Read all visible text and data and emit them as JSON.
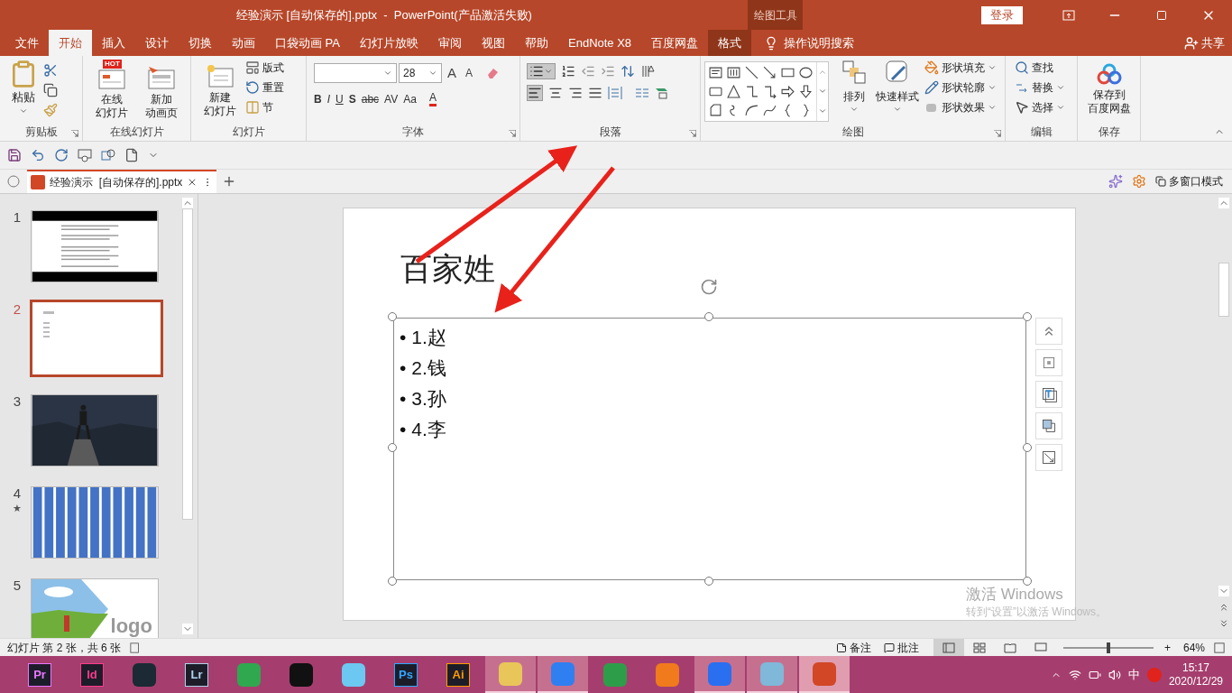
{
  "title_bar": {
    "title": "经验演示 [自动保存的].pptx  -  PowerPoint(产品激活失败)",
    "context_label": "绘图工具",
    "login_button": "登录"
  },
  "menu_tabs": [
    {
      "label": "文件",
      "selected": false,
      "kind": "normal"
    },
    {
      "label": "开始",
      "selected": true,
      "kind": "normal"
    },
    {
      "label": "插入",
      "selected": false,
      "kind": "normal"
    },
    {
      "label": "设计",
      "selected": false,
      "kind": "normal"
    },
    {
      "label": "切换",
      "selected": false,
      "kind": "normal"
    },
    {
      "label": "动画",
      "selected": false,
      "kind": "normal"
    },
    {
      "label": "口袋动画 PA",
      "selected": false,
      "kind": "normal"
    },
    {
      "label": "幻灯片放映",
      "selected": false,
      "kind": "normal"
    },
    {
      "label": "审阅",
      "selected": false,
      "kind": "normal"
    },
    {
      "label": "视图",
      "selected": false,
      "kind": "normal"
    },
    {
      "label": "帮助",
      "selected": false,
      "kind": "normal"
    },
    {
      "label": "EndNote X8",
      "selected": false,
      "kind": "normal"
    },
    {
      "label": "百度网盘",
      "selected": false,
      "kind": "normal"
    },
    {
      "label": "格式",
      "selected": false,
      "kind": "contextual"
    }
  ],
  "tell_me": "操作说明搜索",
  "share": "共享",
  "ribbon": {
    "clipboard": {
      "label": "剪贴板",
      "paste": "粘贴"
    },
    "online_slides": {
      "label": "在线幻灯片",
      "hot_badge": "HOT",
      "buttons": [
        [
          "在线",
          "幻灯片"
        ],
        [
          "新加",
          "动画页"
        ]
      ]
    },
    "slides": {
      "label": "幻灯片",
      "new_slide": [
        "新建",
        "幻灯片"
      ],
      "items": [
        "版式",
        "重置",
        "节"
      ]
    },
    "font": {
      "label": "字体",
      "font_size": "28",
      "grow_shrink": [
        "A",
        "A"
      ],
      "format_buttons": [
        "B",
        "I",
        "U",
        "S",
        "abc",
        "AV",
        "Aa",
        "A"
      ]
    },
    "paragraph": {
      "label": "段落"
    },
    "drawing": {
      "label": "绘图",
      "arrange": "排列",
      "quick_styles": "快速样式",
      "shape_items": [
        "形状填充",
        "形状轮廓",
        "形状效果"
      ]
    },
    "editing": {
      "label": "编辑",
      "items": [
        "查找",
        "替换",
        "选择"
      ]
    },
    "save": {
      "label": "保存",
      "button": [
        "保存到",
        "百度网盘"
      ]
    }
  },
  "doc_tab": {
    "title": "经验演示  [自动保存的].pptx",
    "multi_window": "多窗口模式"
  },
  "slides": [
    {
      "number": "1",
      "selected": false,
      "kind": "text"
    },
    {
      "number": "2",
      "selected": true,
      "kind": "list"
    },
    {
      "number": "3",
      "selected": false
    },
    {
      "number": "4",
      "selected": false,
      "mark": "★",
      "kind": "stripes"
    },
    {
      "number": "5",
      "selected": false,
      "kind": "logo",
      "logo_text": "logo"
    }
  ],
  "slide": {
    "title": "百家姓",
    "bullet": "•",
    "items": [
      "1.赵",
      "2.钱",
      "3.孙",
      "4.李"
    ],
    "activation": [
      "激活 Windows",
      "转到“设置”以激活 Windows。"
    ]
  },
  "status_bar": {
    "slide_info": "幻灯片 第 2 张，共 6 张",
    "notes": "备注",
    "comments": "批注",
    "zoom_in": "+",
    "zoom": "64%",
    "level": 0.5
  },
  "taskbar": {
    "apps": [
      {
        "kind": "badge",
        "text": "Pr",
        "color": "#ea77ff",
        "open": false,
        "selected": false
      },
      {
        "kind": "badge",
        "text": "Id",
        "color": "#ff3a8c",
        "open": false,
        "selected": false
      },
      {
        "kind": "icon",
        "color": "#1b2a35",
        "open": false,
        "selected": false
      },
      {
        "kind": "badge",
        "text": "Lr",
        "color": "#add5ec",
        "open": false,
        "selected": false
      },
      {
        "kind": "icon",
        "color": "#2fa84f",
        "open": false,
        "selected": false
      },
      {
        "kind": "icon",
        "color": "#111111",
        "open": false,
        "selected": false
      },
      {
        "kind": "icon",
        "color": "#6cc8f0",
        "open": false,
        "selected": false
      },
      {
        "kind": "badge",
        "text": "Ps",
        "color": "#31a8ff",
        "open": false,
        "selected": false
      },
      {
        "kind": "badge",
        "text": "Ai",
        "color": "#ff9a00",
        "open": false,
        "selected": false
      },
      {
        "kind": "icon",
        "color": "#e8c65a",
        "open": true,
        "selected": false
      },
      {
        "kind": "icon",
        "color": "#2f7ff0",
        "open": true,
        "selected": false
      },
      {
        "kind": "icon",
        "color": "#2e9d4a",
        "open": false,
        "selected": false
      },
      {
        "kind": "icon",
        "color": "#f07a1c",
        "open": false,
        "selected": false
      },
      {
        "kind": "icon",
        "color": "#2a6ff0",
        "open": true,
        "selected": false
      },
      {
        "kind": "icon",
        "color": "#7fb8d8",
        "open": true,
        "selected": false
      },
      {
        "kind": "icon",
        "color": "#d24726",
        "open": true,
        "selected": true
      }
    ],
    "ime": "中",
    "time": "15:17",
    "date": "2020/12/29"
  }
}
